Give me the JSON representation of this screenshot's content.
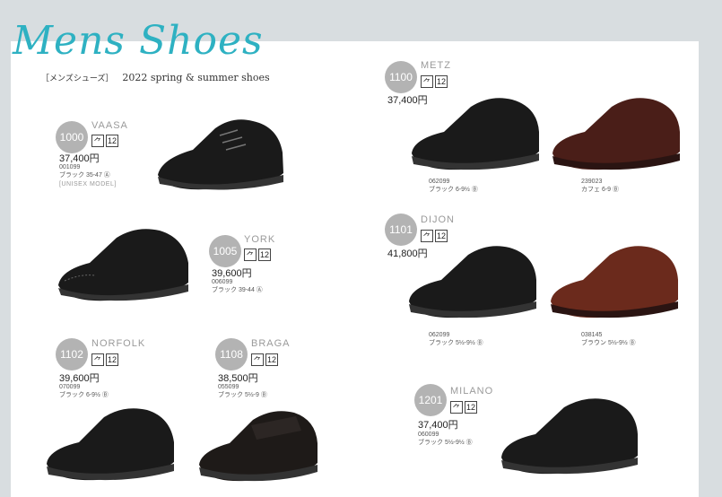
{
  "header": {
    "title": "Mens Shoes",
    "jp": "［メンズシューズ］",
    "subtitle": "2022 spring & summer shoes"
  },
  "products": {
    "p1000": {
      "num": "1000",
      "name": "VAASA",
      "price": "37,400円",
      "code": "001099",
      "variant": "ブラック 35-47 Ⓐ",
      "note": "[UNISEX MODEL]"
    },
    "p1005": {
      "num": "1005",
      "name": "YORK",
      "price": "39,600円",
      "code": "006099",
      "variant": "ブラック 39-44 Ⓐ"
    },
    "p1102": {
      "num": "1102",
      "name": "NORFOLK",
      "price": "39,600円",
      "code": "070099",
      "variant": "ブラック 6-9½ Ⓑ"
    },
    "p1108": {
      "num": "1108",
      "name": "BRAGA",
      "price": "38,500円",
      "code": "055099",
      "variant": "ブラック 5½-9 Ⓑ"
    },
    "p1100": {
      "num": "1100",
      "name": "METZ",
      "price": "37,400円",
      "code1": "062099",
      "variant1": "ブラック 6-9½ Ⓑ",
      "code2": "239023",
      "variant2": "カフェ 6-9 Ⓑ"
    },
    "p1101": {
      "num": "1101",
      "name": "DIJON",
      "price": "41,800円",
      "code1": "062099",
      "variant1": "ブラック 5½-9½ Ⓑ",
      "code2": "038145",
      "variant2": "ブラウン 5½-9½ Ⓑ"
    },
    "p1201": {
      "num": "1201",
      "name": "MILANO",
      "price": "37,400円",
      "code": "060099",
      "variant": "ブラック 5½-9½ Ⓑ"
    }
  },
  "icon_labels": {
    "toe": "⺈",
    "width": "12"
  },
  "colors": {
    "accent": "#2eb1c2",
    "badge": "#b3b3b3",
    "black_leather": "#1a1a1a",
    "brown_leather": "#6b2a1c"
  }
}
